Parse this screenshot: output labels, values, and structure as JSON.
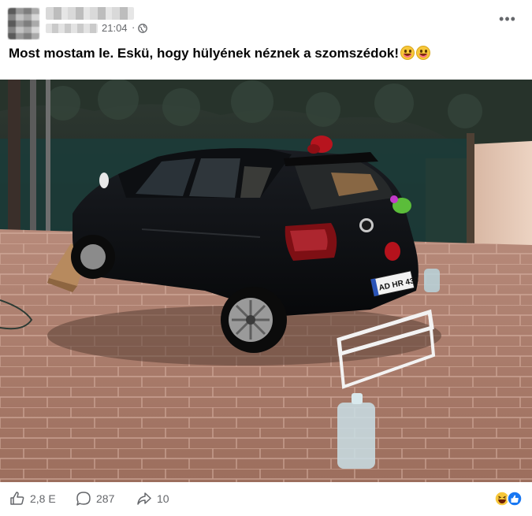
{
  "post": {
    "timestamp": "21:04",
    "separator": "·",
    "text": "Most mostam le. Eskü, hogy hülyének néznek a szomszédok!",
    "text_emojis": [
      "grinning-squinting-face",
      "grinning-squinting-face"
    ],
    "more_label": "•••"
  },
  "photo": {
    "plate_text": "AD HR 430"
  },
  "footer": {
    "likes": "2,8 E",
    "comments": "287",
    "shares": "10",
    "reaction_icons": [
      "haha",
      "like"
    ]
  },
  "colors": {
    "secondary_text": "#65676b",
    "like_blue": "#1877f2",
    "haha_yellow": "#f7c73a"
  }
}
